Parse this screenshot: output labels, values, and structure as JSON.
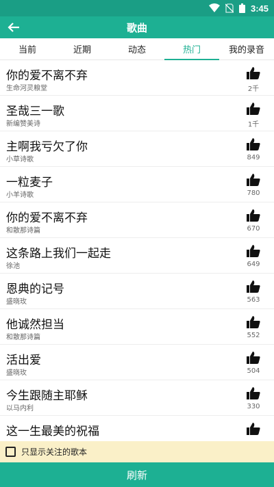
{
  "status_bar": {
    "time": "3:45"
  },
  "header": {
    "title": "歌曲"
  },
  "tabs": [
    {
      "label": "当前",
      "active": false
    },
    {
      "label": "近期",
      "active": false
    },
    {
      "label": "动态",
      "active": false
    },
    {
      "label": "热门",
      "active": true
    },
    {
      "label": "我的录音",
      "active": false
    }
  ],
  "songs": [
    {
      "title": "你的爱不离不弃",
      "source": "生命河灵粮堂",
      "likes": "2千"
    },
    {
      "title": "圣哉三一歌",
      "source": "新编赞美诗",
      "likes": "1千"
    },
    {
      "title": "主啊我亏欠了你",
      "source": "小草诗歌",
      "likes": "849"
    },
    {
      "title": "一粒麦子",
      "source": "小羊诗歌",
      "likes": "780"
    },
    {
      "title": "你的爱不离不弃",
      "source": "和散那诗篇",
      "likes": "670"
    },
    {
      "title": "这条路上我们一起走",
      "source": "徐池",
      "likes": "649"
    },
    {
      "title": "恩典的记号",
      "source": "盛晓玫",
      "likes": "563"
    },
    {
      "title": "他诚然担当",
      "source": "和散那诗篇",
      "likes": "552"
    },
    {
      "title": "活出爱",
      "source": "盛晓玫",
      "likes": "504"
    },
    {
      "title": "今生跟随主耶稣",
      "source": "以马内利",
      "likes": "330"
    },
    {
      "title": "这一生最美的祝福",
      "source": "",
      "likes": ""
    }
  ],
  "filter": {
    "label": "只显示关注的歌本",
    "checked": false
  },
  "footer": {
    "refresh_label": "刷新"
  },
  "colors": {
    "accent": "#1db093",
    "status_bar": "#1a9e85",
    "filter_bg": "#faf0c8"
  }
}
